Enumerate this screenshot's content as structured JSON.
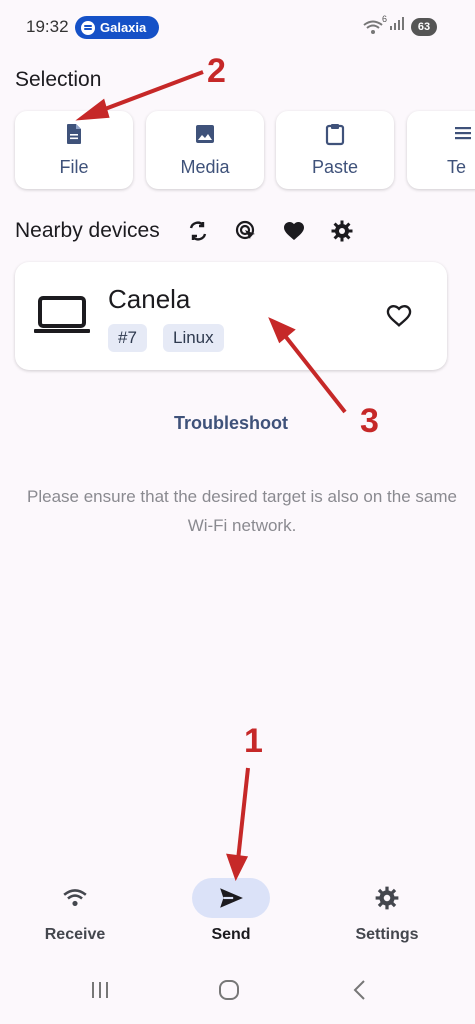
{
  "status_bar": {
    "time": "19:32",
    "spotify_label": "Galaxia",
    "battery": "63",
    "wifi_badge": "6"
  },
  "selection": {
    "title": "Selection",
    "items": [
      {
        "label": "File",
        "icon": "file-icon"
      },
      {
        "label": "Media",
        "icon": "image-icon"
      },
      {
        "label": "Paste",
        "icon": "clipboard-icon"
      },
      {
        "label": "Te",
        "icon": "text-icon"
      }
    ]
  },
  "nearby": {
    "title": "Nearby devices",
    "icons": [
      "refresh-icon",
      "cursor-target-icon",
      "heart-icon",
      "settings-icon"
    ]
  },
  "device": {
    "name": "Canela",
    "tags": [
      "#7",
      "Linux"
    ],
    "icon": "laptop-icon"
  },
  "troubleshoot": "Troubleshoot",
  "hint": "Please ensure that the desired target is also on the same Wi-Fi network.",
  "bottom_nav": {
    "items": [
      {
        "label": "Receive",
        "icon": "wifi-icon"
      },
      {
        "label": "Send",
        "icon": "send-icon"
      },
      {
        "label": "Settings",
        "icon": "gear-icon"
      }
    ],
    "active": "Send"
  },
  "annotations": [
    "1",
    "2",
    "3"
  ],
  "colors": {
    "accent": "#3f527a",
    "active_pill": "#dbe2f8",
    "annotation_red": "#c62828",
    "background": "#fcf8fc"
  }
}
